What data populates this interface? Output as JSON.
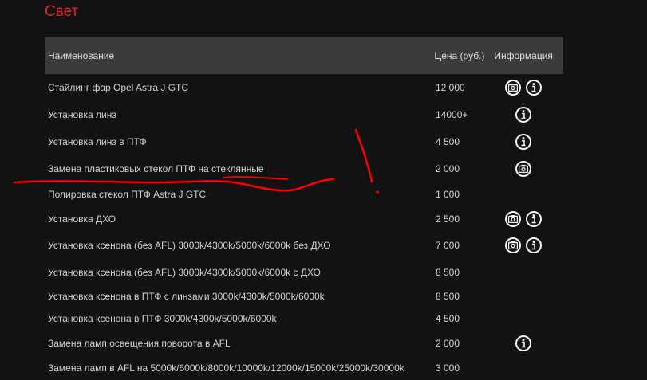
{
  "section": {
    "title": "Свет"
  },
  "table": {
    "headers": {
      "name": "Наименование",
      "price": "Цена (руб.)",
      "info": "Информация"
    },
    "rows": [
      {
        "name": "Стайлинг фар Opel Astra J GTC",
        "price": "12 000",
        "icons": [
          "camera-icon",
          "info-icon"
        ]
      },
      {
        "name": "Установка линз",
        "price": "14000+",
        "icons": [
          "info-icon"
        ]
      },
      {
        "name": "Установка линз в ПТФ",
        "price": "4 500",
        "icons": [
          "info-icon"
        ]
      },
      {
        "name": "Замена пластиковых стекол ПТФ на стеклянные",
        "price": "2 000",
        "icons": [
          "camera-icon"
        ]
      },
      {
        "name": "Полировка стекол ПТФ Astra J GTC",
        "price": "1 000",
        "icons": []
      },
      {
        "name": "Установка ДХО",
        "price": "2 500",
        "icons": [
          "camera-icon",
          "info-icon"
        ]
      },
      {
        "name": "Установка ксенона (без AFL) 3000k/4300k/5000k/6000k без ДХО",
        "price": "7 000",
        "icons": [
          "camera-icon",
          "info-icon"
        ]
      },
      {
        "name": "Установка ксенона (без AFL) 3000k/4300k/5000k/6000k с ДХО",
        "price": "8 500",
        "icons": []
      },
      {
        "name": "Установка ксенона в ПТФ с линзами 3000k/4300k/5000k/6000k",
        "price": "8 500",
        "icons": []
      },
      {
        "name": "Установка ксенона в ПТФ 3000k/4300k/5000k/6000k",
        "price": "4 500",
        "icons": []
      },
      {
        "name": "Замена ламп освещения поворота в AFL",
        "price": "2 000",
        "icons": [
          "info-icon"
        ]
      },
      {
        "name": "Замена ламп в AFL на 5000k/6000k/8000k/10000k/12000k/15000k/25000k/30000k",
        "price": "3 000",
        "icons": []
      }
    ]
  },
  "colors": {
    "accent": "#e0262d",
    "header_bg": "#3b3b3b",
    "page_bg": "#121212",
    "annotation": "#ff0000"
  }
}
